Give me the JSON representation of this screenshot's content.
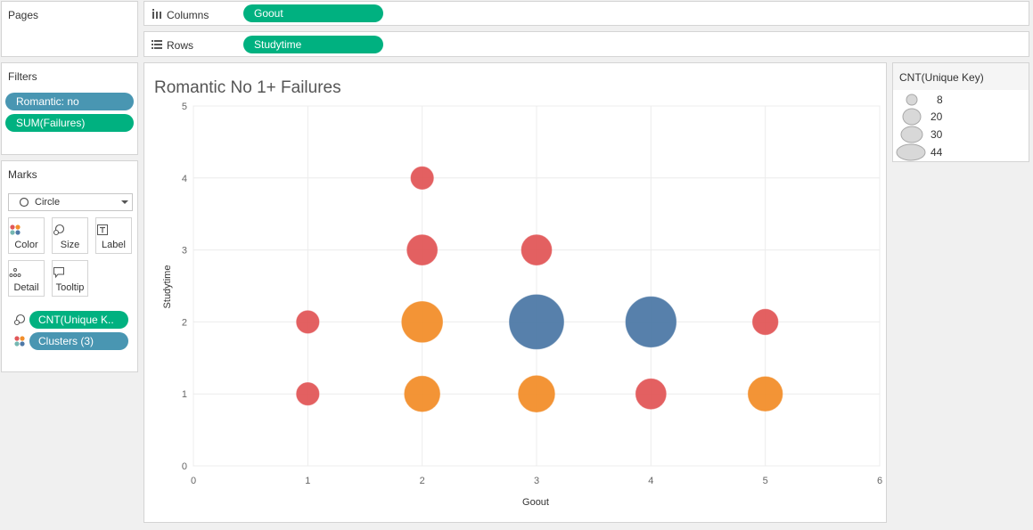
{
  "pages": {
    "title": "Pages"
  },
  "shelves": {
    "columns": {
      "label": "Columns",
      "pill": "Goout"
    },
    "rows": {
      "label": "Rows",
      "pill": "Studytime"
    }
  },
  "filters": {
    "title": "Filters",
    "pills": [
      "Romantic: no",
      "SUM(Failures)"
    ]
  },
  "marks": {
    "title": "Marks",
    "type": "Circle",
    "buttons": [
      "Color",
      "Size",
      "Label",
      "Detail",
      "Tooltip"
    ],
    "encodings": [
      {
        "icon": "size-icon",
        "label": "CNT(Unique K.."
      },
      {
        "icon": "color-icon",
        "label": "Clusters (3)"
      }
    ]
  },
  "legend": {
    "title": "CNT(Unique Key)",
    "items": [
      "8",
      "20",
      "30",
      "44"
    ]
  },
  "colors": {
    "green_pill": "#00b180",
    "blue_pill": "#4996b2",
    "cluster_red": "#e15759",
    "cluster_orange": "#f28e2b",
    "cluster_blue": "#4e79a7"
  },
  "chart_data": {
    "type": "scatter",
    "title": "Romantic No 1+ Failures",
    "xlabel": "Goout",
    "ylabel": "Studytime",
    "xlim": [
      0,
      6
    ],
    "ylim": [
      0,
      5
    ],
    "x_ticks": [
      "0",
      "1",
      "2",
      "3",
      "4",
      "5",
      "6"
    ],
    "y_ticks": [
      "0",
      "1",
      "2",
      "3",
      "4",
      "5"
    ],
    "grid": true,
    "size_field": "CNT(Unique Key)",
    "color_field": "Clusters (3)",
    "points": [
      {
        "x": 2,
        "y": 4,
        "size": 8,
        "cluster": "red"
      },
      {
        "x": 2,
        "y": 3,
        "size": 14,
        "cluster": "red"
      },
      {
        "x": 3,
        "y": 3,
        "size": 14,
        "cluster": "red"
      },
      {
        "x": 1,
        "y": 2,
        "size": 8,
        "cluster": "red"
      },
      {
        "x": 2,
        "y": 2,
        "size": 25,
        "cluster": "orange"
      },
      {
        "x": 3,
        "y": 2,
        "size": 44,
        "cluster": "blue"
      },
      {
        "x": 4,
        "y": 2,
        "size": 38,
        "cluster": "blue"
      },
      {
        "x": 5,
        "y": 2,
        "size": 10,
        "cluster": "red"
      },
      {
        "x": 1,
        "y": 1,
        "size": 8,
        "cluster": "red"
      },
      {
        "x": 2,
        "y": 1,
        "size": 19,
        "cluster": "orange"
      },
      {
        "x": 3,
        "y": 1,
        "size": 20,
        "cluster": "orange"
      },
      {
        "x": 4,
        "y": 1,
        "size": 14,
        "cluster": "red"
      },
      {
        "x": 5,
        "y": 1,
        "size": 18,
        "cluster": "orange"
      }
    ]
  }
}
